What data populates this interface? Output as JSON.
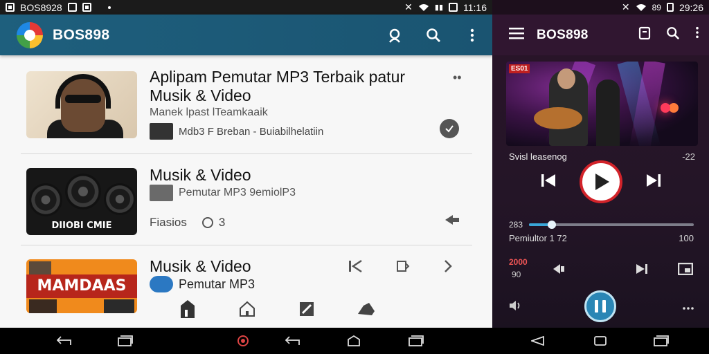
{
  "left_app": {
    "status": {
      "carrier": "BOS8928",
      "time": "11:16"
    },
    "header": {
      "title": "BOS898"
    },
    "rows": [
      {
        "title": "Aplipam Pemutar MP3 Terbaik patur Musik & Video",
        "subtitle": "Manek lpast lTeamkaaik",
        "meta": "Mdb3 F Breban - Buiabilhelatiin",
        "thumb_badge": ""
      },
      {
        "title": "Musik & Video",
        "subtitle": "Pemutar MP3 9emiolP3",
        "meta_left": "Fiasios",
        "meta_count": "3",
        "thumb_caption": "DIIOBI CMIE"
      },
      {
        "title": "Musik & Video",
        "subtitle": "Pemutar MP3",
        "thumb_banner": "MAMDAAS"
      }
    ]
  },
  "player": {
    "status": {
      "battery": "89",
      "time": "29:26"
    },
    "header": {
      "title": "BOS898"
    },
    "art_badge": "ES01",
    "now_playing": "Svisl leasenog",
    "now_playing_right": "-22",
    "seek": {
      "current": "283",
      "progress": 0.14
    },
    "info_left": "Pemiultor 1 72",
    "info_right": "100",
    "mini": {
      "time": "2000",
      "time2": "90"
    },
    "colors": {
      "accent": "#d2232a",
      "seek": "#3aa6d8",
      "pause": "#2a86b5"
    }
  }
}
